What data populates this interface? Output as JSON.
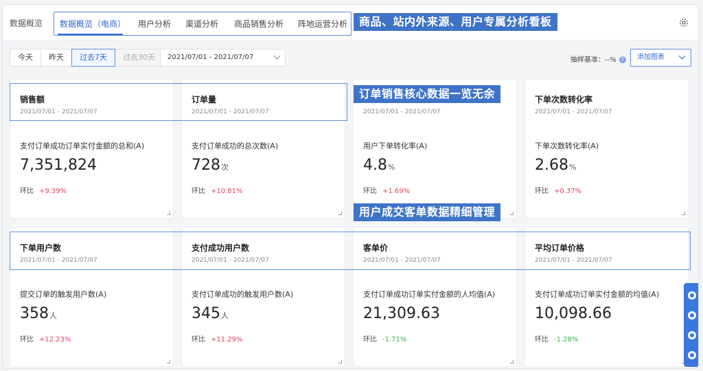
{
  "header": {
    "crumb": "数据概览",
    "tabs": [
      {
        "label": "数据概览（电商）",
        "active": true
      },
      {
        "label": "用户分析",
        "active": false
      },
      {
        "label": "渠道分析",
        "active": false
      },
      {
        "label": "商品销售分析",
        "active": false
      },
      {
        "label": "阵地运营分析",
        "active": false
      }
    ]
  },
  "annotations": {
    "banner1": "商品、站内外来源、用户专属分析看板",
    "banner2": "订单销售核心数据一览无余",
    "banner3": "用户成交客单数据精细管理"
  },
  "toolbar": {
    "buttons": [
      "今天",
      "昨天",
      "过去7天",
      "过去30天"
    ],
    "active_button": "过去7天",
    "disabled_button": "过去30天",
    "date_range": "2021/07/01 - 2021/07/07",
    "sample_label": "抽样基准：--%",
    "sample_help": "?",
    "add_chart": "添加图表"
  },
  "cards": [
    {
      "title": "销售额",
      "date": "2021/07/01 - 2021/07/07",
      "desc": "支付订单成功订单实付金额的总和(A)",
      "value": "7,351,824",
      "unit": "",
      "cmp_label": "环比",
      "delta": "+9.39%",
      "dir": "up"
    },
    {
      "title": "订单量",
      "date": "2021/07/01 - 2021/07/07",
      "desc": "支付订单成功的总次数(A)",
      "value": "728",
      "unit": "次",
      "cmp_label": "环比",
      "delta": "+10.81%",
      "dir": "up"
    },
    {
      "title": "",
      "date": "2021/07/01 - 2021/07/07",
      "desc": "用户下单转化率(A)",
      "value": "4.8",
      "unit": "%",
      "cmp_label": "环比",
      "delta": "+1.69%",
      "dir": "up"
    },
    {
      "title": "下单次数转化率",
      "date": "2021/07/01 - 2021/07/07",
      "desc": "下单次数转化率(A)",
      "value": "2.68",
      "unit": "%",
      "cmp_label": "环比",
      "delta": "+0.37%",
      "dir": "up"
    },
    {
      "title": "下单用户数",
      "date": "2021/07/01 - 2021/07/07",
      "desc": "提交订单的触发用户数(A)",
      "value": "358",
      "unit": "人",
      "cmp_label": "环比",
      "delta": "+12.23%",
      "dir": "up"
    },
    {
      "title": "支付成功用户数",
      "date": "2021/07/01 - 2021/07/07",
      "desc": "支付订单成功的触发用户数(A)",
      "value": "345",
      "unit": "人",
      "cmp_label": "环比",
      "delta": "+11.29%",
      "dir": "up"
    },
    {
      "title": "客单价",
      "date": "2021/07/01 - 2021/07/07",
      "desc": "支付订单成功订单实付金额的人均值(A)",
      "value": "21,309.63",
      "unit": "",
      "cmp_label": "环比",
      "delta": "-1.71%",
      "dir": "down"
    },
    {
      "title": "平均订单价格",
      "date": "2021/07/01 - 2021/07/07",
      "desc": "支付订单成功订单实付金额的均值(A)",
      "value": "10,098.66",
      "unit": "",
      "cmp_label": "环比",
      "delta": "-1.28%",
      "dir": "down"
    }
  ],
  "floatbar": {
    "icons": [
      "refresh-icon",
      "compass-icon",
      "chat-icon",
      "add-icon"
    ]
  },
  "colors": {
    "accent": "#2d6bd6",
    "banner": "#3f73c7",
    "up": "#e2425d",
    "down": "#3fae49"
  }
}
